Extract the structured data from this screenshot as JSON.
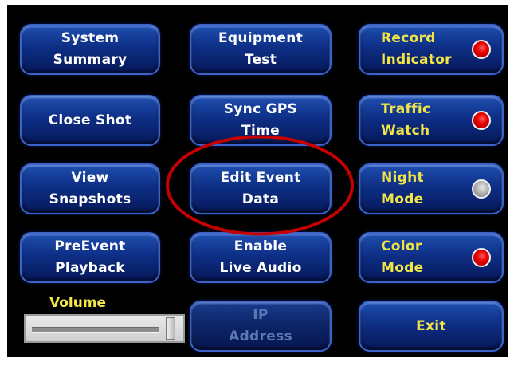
{
  "buttons": {
    "system_summary": "System\nSummary",
    "equipment_test": "Equipment\nTest",
    "record_indicator": "Record\nIndicator",
    "close_shot": "Close Shot",
    "sync_gps_time": "Sync GPS\nTime",
    "traffic_watch": "Traffic\nWatch",
    "view_snapshots": "View\nSnapshots",
    "edit_event_data": "Edit Event\nData",
    "night_mode": "Night\nMode",
    "preevent_playback": "PreEvent\nPlayback",
    "enable_live_audio": "Enable\nLive Audio",
    "color_mode": "Color\nMode",
    "ip_address": "IP\nAddress",
    "exit": "Exit"
  },
  "volume": {
    "label": "Volume",
    "level": 0.9
  },
  "indicators": {
    "record_indicator": "red",
    "traffic_watch": "red",
    "night_mode": "gray",
    "color_mode": "red"
  },
  "colors": {
    "button_text": "#ffffff",
    "toggle_text": "#f2e646",
    "annotation": "#c40000"
  }
}
